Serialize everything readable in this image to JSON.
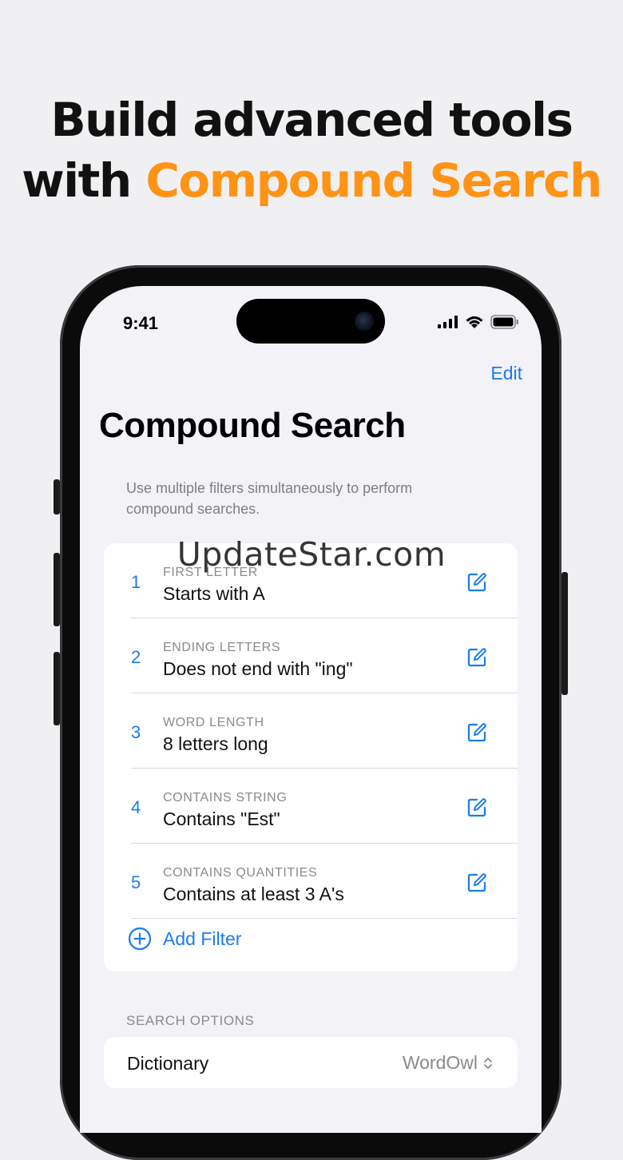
{
  "headline": {
    "line1": "Build advanced tools",
    "line2_prefix": "with ",
    "line2_accent": "Compound Search"
  },
  "status_bar": {
    "time": "9:41",
    "icons": [
      "cellular-signal-icon",
      "wifi-icon",
      "battery-icon"
    ]
  },
  "nav": {
    "edit_label": "Edit"
  },
  "page": {
    "title": "Compound Search",
    "description": "Use multiple filters simultaneously to perform compound searches."
  },
  "filters": [
    {
      "number": "1",
      "label": "FIRST LETTER",
      "value": "Starts with A"
    },
    {
      "number": "2",
      "label": "ENDING LETTERS",
      "value": "Does not end with \"ing\""
    },
    {
      "number": "3",
      "label": "WORD LENGTH",
      "value": "8 letters long"
    },
    {
      "number": "4",
      "label": "CONTAINS STRING",
      "value": "Contains \"Est\""
    },
    {
      "number": "5",
      "label": "CONTAINS QUANTITIES",
      "value": "Contains at least 3 A's"
    }
  ],
  "add_filter_label": "Add Filter",
  "search_options": {
    "header": "SEARCH OPTIONS",
    "dictionary_label": "Dictionary",
    "dictionary_value": "WordOwl"
  },
  "watermark": "UpdateStar.com",
  "colors": {
    "accent_orange": "#ff9315",
    "ios_blue": "#1a7cf0",
    "background": "#f0f0f2"
  }
}
